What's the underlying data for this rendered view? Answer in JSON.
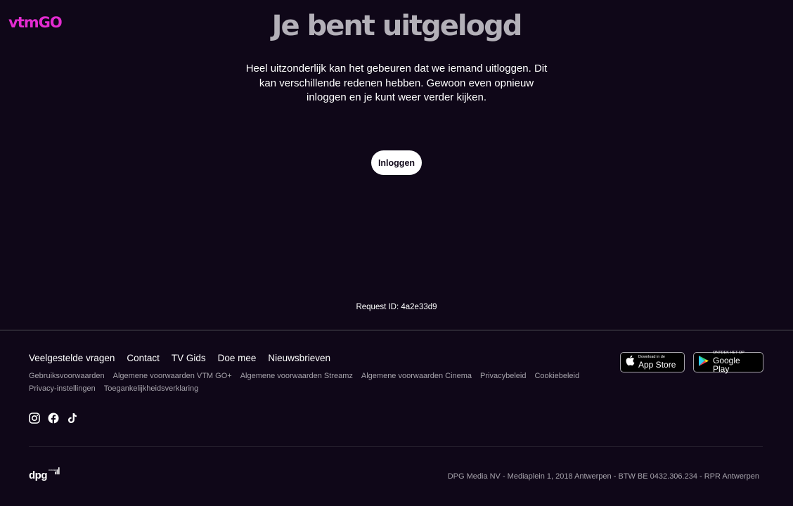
{
  "header": {
    "logo_text": "vtmGO",
    "brand_color": "#e42bd1"
  },
  "main": {
    "title": "Je bent uitgelogd",
    "intro_lines": [
      "Heel uitzonderlijk kan het gebeuren dat we iemand uitloggen. Dit",
      "kan verschillende redenen hebben. Gewoon even opnieuw",
      "inloggen en je kunt weer verder kijken."
    ],
    "login_button": "Inloggen",
    "request_id": "Request ID: 4a2e33d9"
  },
  "footer": {
    "nav": [
      "Veelgestelde vragen",
      "Contact",
      "TV Gids",
      "Doe mee",
      "Nieuwsbrieven"
    ],
    "links_row1": [
      "Gebruiksvoorwaarden",
      "Algemene voorwaarden VTM GO+",
      "Algemene voorwaarden Streamz",
      "Algemene voorwaarden Cinema",
      "Privacybeleid",
      "Cookiebeleid"
    ],
    "links_row2": [
      "Privacy-instellingen",
      "Toegankelijkheidsverklaring"
    ],
    "app_store": {
      "small": "Download in de",
      "large": "App Store",
      "icon": "apple-icon"
    },
    "google_play": {
      "small": "ONTDEK HET OP",
      "large": "Google Play",
      "icon": "google-play-icon"
    },
    "social_icons": [
      "instagram-icon",
      "facebook-icon",
      "tiktok-icon"
    ],
    "dpg_logo": {
      "small": "media",
      "word": "dpg"
    },
    "legal": "DPG Media NV -  Mediaplein 1, 2018 Antwerpen  -  BTW BE 0432.306.234 -  RPR Antwerpen"
  }
}
